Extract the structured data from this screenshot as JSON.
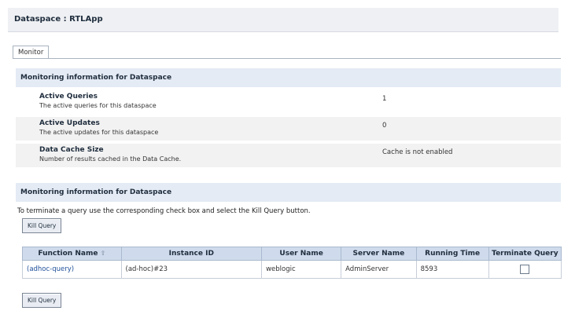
{
  "page": {
    "title": "Dataspace : RTLApp"
  },
  "tabs": [
    {
      "label": "Monitor"
    }
  ],
  "section1": {
    "header": "Monitoring information for Dataspace",
    "rows": [
      {
        "label": "Active Queries",
        "description": "The active queries for this dataspace",
        "value": "1"
      },
      {
        "label": "Active Updates",
        "description": "The active updates for this dataspace",
        "value": "0"
      },
      {
        "label": "Data Cache Size",
        "description": "Number of results cached in the Data Cache.",
        "value": "Cache is not enabled"
      }
    ]
  },
  "section2": {
    "header": "Monitoring information for Dataspace",
    "instruction": "To terminate a query use the corresponding check box and select the Kill Query button.",
    "kill_button_label": "Kill Query",
    "table": {
      "columns": [
        "Function Name",
        "Instance ID",
        "User Name",
        "Server Name",
        "Running Time",
        "Terminate Query"
      ],
      "rows": [
        {
          "function_name": "(adhoc-query)",
          "instance_id": "(ad-hoc)#23",
          "user_name": "weblogic",
          "server_name": "AdminServer",
          "running_time": "8593",
          "terminate_checked": false
        }
      ]
    }
  },
  "icons": {
    "sort": "sort-icon"
  }
}
